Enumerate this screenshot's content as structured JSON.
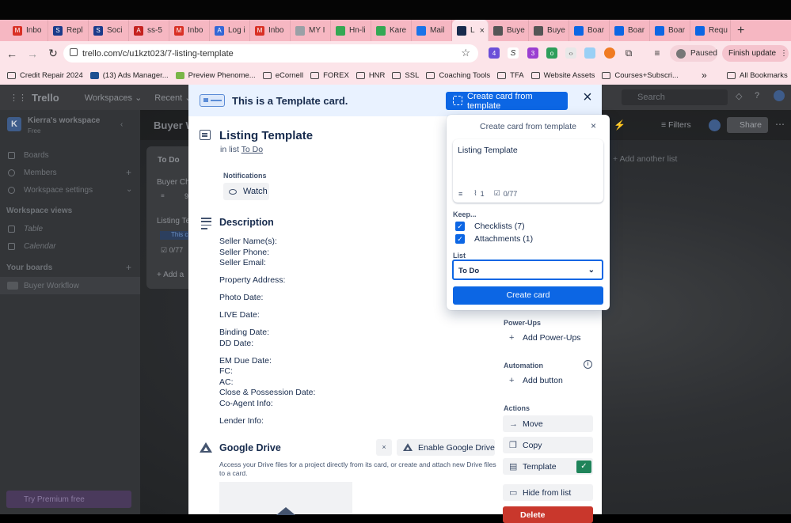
{
  "browser": {
    "tabs": [
      {
        "label": "Inbo",
        "color": "#d93025",
        "glyph": "M"
      },
      {
        "label": "Repl",
        "color": "#1a3a8a",
        "glyph": "S"
      },
      {
        "label": "Soci",
        "color": "#1a3a8a",
        "glyph": "S"
      },
      {
        "label": "ss-5",
        "color": "#c5221f",
        "glyph": "A"
      },
      {
        "label": "Inbo",
        "color": "#d93025",
        "glyph": "M"
      },
      {
        "label": "Log i",
        "color": "#3367d6",
        "glyph": "A"
      },
      {
        "label": "Inbo",
        "color": "#d93025",
        "glyph": "M"
      },
      {
        "label": "MY I",
        "color": "#9aa0a6",
        "glyph": ""
      },
      {
        "label": "Hn-li",
        "color": "#34a853",
        "glyph": ""
      },
      {
        "label": "Kare",
        "color": "#34a853",
        "glyph": ""
      },
      {
        "label": "Mail",
        "color": "#1a73e8",
        "glyph": ""
      }
    ],
    "active_tab": {
      "label": "L",
      "close": "×"
    },
    "tabs_after": [
      {
        "label": "Buye",
        "color": "#555555"
      },
      {
        "label": "Buye",
        "color": "#555555"
      },
      {
        "label": "Boar",
        "color": "#0c66e4"
      },
      {
        "label": "Boar",
        "color": "#0c66e4"
      },
      {
        "label": "Boar",
        "color": "#0c66e4"
      },
      {
        "label": "Requ",
        "color": "#0c66e4"
      }
    ],
    "new_tab": "+",
    "url": "trello.com/c/u1kzt023/7-listing-template",
    "paused": "Paused",
    "finish_update": "Finish update",
    "bookmarks": [
      {
        "label": "Credit Repair 2024",
        "icon": "folder"
      },
      {
        "label": "(13) Ads Manager...",
        "icon": "meta"
      },
      {
        "label": "Preview Phenome...",
        "icon": "shopify"
      },
      {
        "label": "eCornell",
        "icon": "folder"
      },
      {
        "label": "FOREX",
        "icon": "folder"
      },
      {
        "label": "HNR",
        "icon": "folder"
      },
      {
        "label": "SSL",
        "icon": "folder"
      },
      {
        "label": "Coaching Tools",
        "icon": "folder"
      },
      {
        "label": "TFA",
        "icon": "folder"
      },
      {
        "label": "Website Assets",
        "icon": "folder"
      },
      {
        "label": "Courses+Subscri...",
        "icon": "folder"
      }
    ],
    "bookmarks_more": "»",
    "all_bookmarks": "All Bookmarks"
  },
  "trello": {
    "logo": "Trello",
    "nav": [
      "Workspaces",
      "Recent"
    ],
    "search_placeholder": "Search",
    "workspace_name": "Kierra's workspace",
    "workspace_plan": "Free",
    "workspace_initial": "K",
    "sidebar_items": [
      "Boards",
      "Members",
      "Workspace settings"
    ],
    "workspace_views_label": "Workspace views",
    "views": [
      "Table",
      "Calendar"
    ],
    "your_boards_label": "Your boards",
    "boards": [
      "Buyer Workflow"
    ],
    "premium": "Try Premium free",
    "board_title": "Buyer W",
    "board_filters": "Filters",
    "board_share": "Share",
    "add_another_list": "Add another list",
    "list_title": "To Do",
    "list_cards": [
      "Buyer Ch",
      "Listing Te"
    ],
    "list_card_badge": "This c",
    "list_card_checklist": "0/77",
    "list_add": "Add a",
    "list_card_count": "9"
  },
  "card": {
    "template_banner": "This is a Template card.",
    "create_from_template_btn": "Create card from template",
    "title": "Listing Template",
    "in_list_prefix": "in list",
    "list_name": "To Do",
    "notifications_label": "Notifications",
    "watch_label": "Watch",
    "description_title": "Description",
    "description_lines": [
      "Seller Name(s):",
      "Seller Phone:",
      "Seller Email:",
      "Property Address:",
      "Photo Date:",
      "LIVE Date:",
      "Binding Date:",
      "DD Date:",
      "EM Due Date:",
      "FC:",
      "AC:",
      "Close & Possession Date:",
      "Co-Agent Info:",
      "Lender Info:"
    ],
    "google_drive_title": "Google Drive",
    "google_drive_dismiss": "×",
    "google_drive_enable": "Enable Google Drive",
    "google_drive_text": "Access your Drive files for a project directly from its card, or create and attach new Drive files to a card.",
    "powerups_label": "Power-Ups",
    "add_powerups": "Add Power-Ups",
    "automation_label": "Automation",
    "add_button": "Add button",
    "actions_label": "Actions",
    "actions": [
      "Move",
      "Copy",
      "Template",
      "Hide from list",
      "Delete"
    ]
  },
  "popover": {
    "title": "Create card from template",
    "close": "×",
    "card_title": "Listing Template",
    "attachments_count": "1",
    "checklist_progress": "0/77",
    "keep_label": "Keep...",
    "keep_options": [
      {
        "label": "Checklists (7)",
        "checked": true
      },
      {
        "label": "Attachments (1)",
        "checked": true
      }
    ],
    "list_label": "List",
    "list_value": "To Do",
    "create_button": "Create card"
  }
}
